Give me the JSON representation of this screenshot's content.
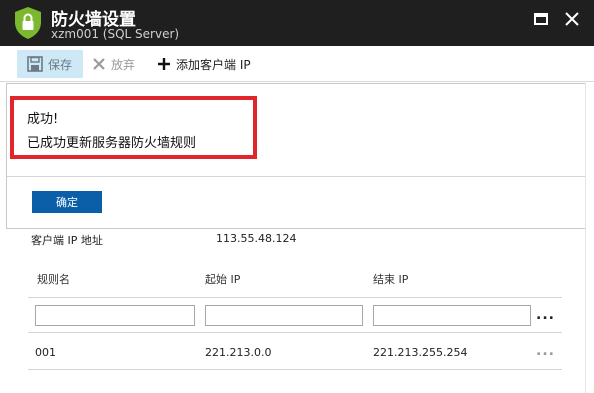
{
  "window": {
    "title": "防火墙设置",
    "subtitle": "xzm001 (SQL Server)",
    "icons": {
      "app": "shield-lock-icon",
      "maximize": "maximize-icon",
      "close": "close-icon"
    }
  },
  "toolbar": {
    "save_label": "保存",
    "discard_label": "放弃",
    "add_client_ip_label": "添加客户端 IP"
  },
  "notification": {
    "title": "成功!",
    "message": "已成功更新服务器防火墙规则",
    "ok_label": "确定",
    "highlight_color": "#e0262a"
  },
  "client_ip": {
    "label": "客户端 IP 地址",
    "value": "113.55.48.124"
  },
  "rules_table": {
    "columns": [
      "规则名",
      "起始 IP",
      "结束 IP"
    ],
    "new_rule": {
      "name": "",
      "start_ip": "",
      "end_ip": ""
    },
    "rows": [
      {
        "name": "001",
        "start_ip": "221.213.0.0",
        "end_ip": "221.213.255.254"
      }
    ],
    "more_label": "..."
  },
  "colors": {
    "titlebar": "#1f1f1f",
    "accent": "#0b5fa8",
    "shield": "#7cb82f",
    "save_highlight": "#cfe8f6"
  }
}
